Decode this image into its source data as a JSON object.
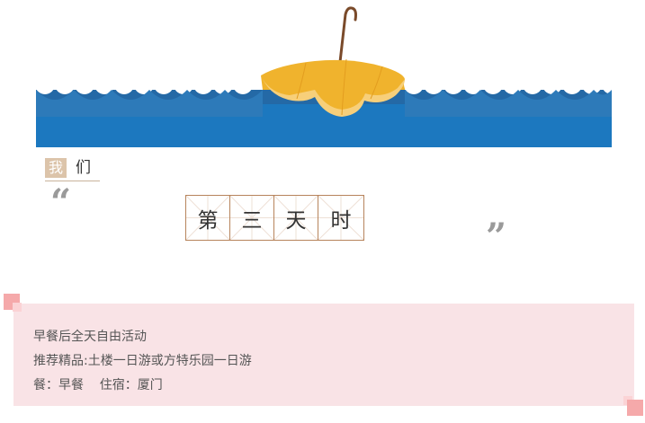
{
  "header": {
    "we_label_first": "我",
    "we_label_second": "们"
  },
  "quote": {
    "open": "“",
    "close": "”"
  },
  "title": {
    "chars": [
      "第",
      "三",
      "天",
      "时"
    ]
  },
  "itinerary": {
    "lines": [
      "早餐后全天自由活动",
      "推荐精品:土楼一日游或方特乐园一日游",
      "餐：早餐    住宿：厦门"
    ]
  },
  "colors": {
    "sea": "#2d7ab9",
    "sea_dark": "#2a6ea8",
    "umbrella": "#f0b32d",
    "umbrella_light": "#f7cf7a",
    "handle": "#7a4a2a",
    "label_bg": "#dcc4aa",
    "grid_border": "#b7845c",
    "info_bg": "#f9e3e6",
    "corner": "#f5a9aa"
  }
}
